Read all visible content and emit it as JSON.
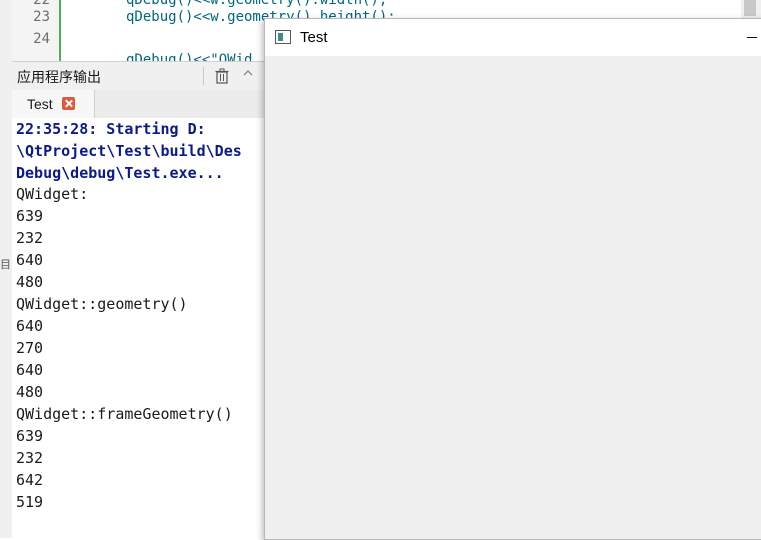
{
  "editor": {
    "line_numbers": [
      "22",
      "23",
      "24"
    ],
    "code_lines": [
      "qDebug()<<w.geometry().width();",
      "qDebug()<<w.geometry().height();",
      "",
      "qDebug()<<\"QWid"
    ]
  },
  "output_pane": {
    "title": "应用程序输出",
    "tabs": [
      {
        "label": "Test"
      }
    ],
    "lines": [
      "22:35:28: Starting D:",
      "\\QtProject\\Test\\build\\Des",
      "Debug\\debug\\Test.exe...",
      "QWidget:",
      "639",
      "232",
      "640",
      "480",
      "QWidget::geometry()",
      "640",
      "270",
      "640",
      "480",
      "QWidget::frameGeometry()",
      "639",
      "232",
      "642",
      "519"
    ]
  },
  "test_window": {
    "title": "Test"
  },
  "icons": {
    "trash": "trash-icon",
    "collapse": "chevron-up-icon",
    "tab_close": "close-icon",
    "window_icon": "qt-window-icon",
    "minimize": "minimize-icon"
  },
  "colors": {
    "output_bold": "#0b1a8a",
    "tab_close": "#e05a3a",
    "fold_marker": "#4caf50"
  }
}
